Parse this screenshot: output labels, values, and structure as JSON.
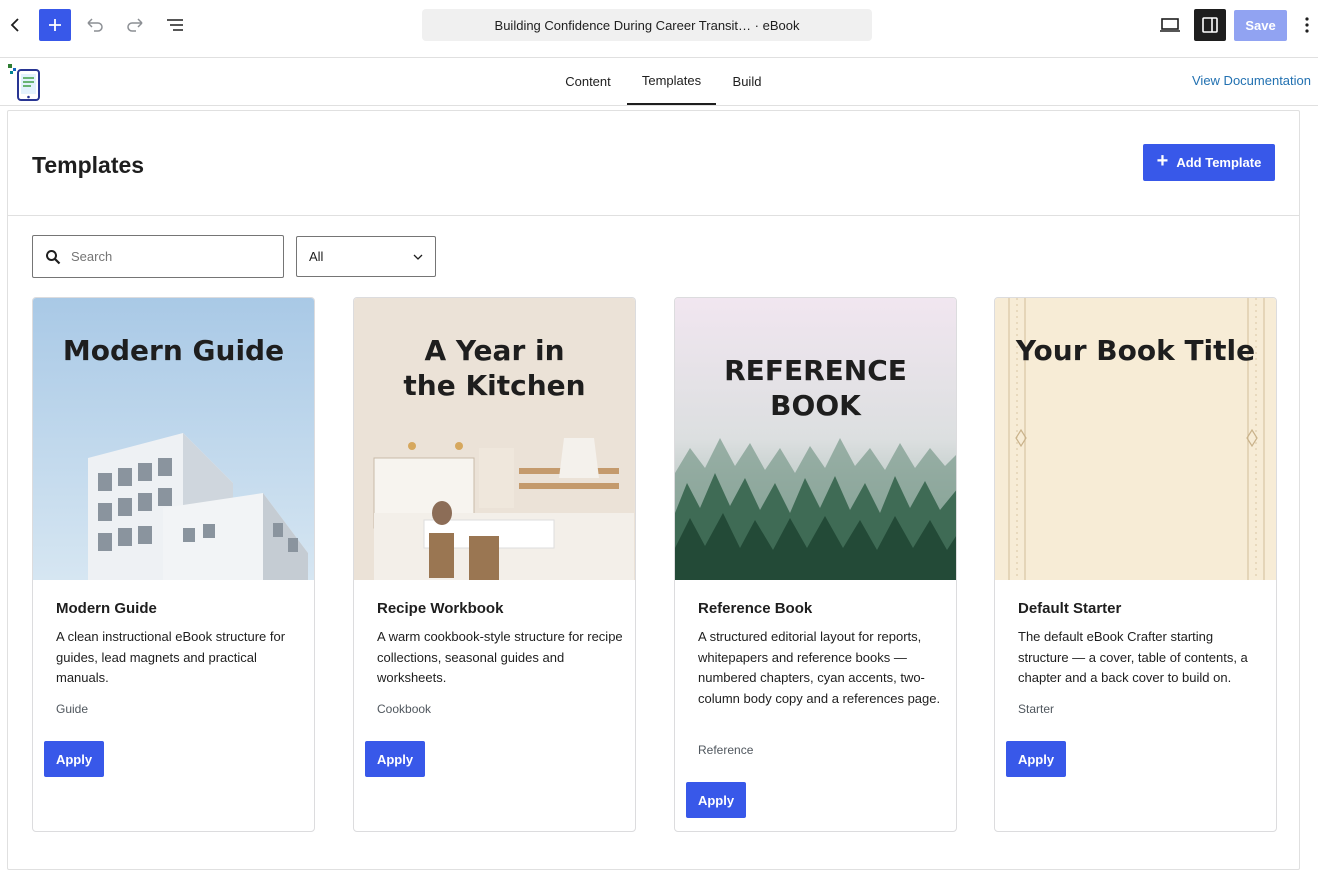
{
  "toolbar": {
    "document_title": "Building Confidence During Career Transit…  · eBook",
    "save_label": "Save",
    "accent_color": "#3858e9"
  },
  "nav": {
    "tabs": [
      {
        "label": "Content"
      },
      {
        "label": "Templates",
        "active": true
      },
      {
        "label": "Build"
      }
    ],
    "docs_link": "View Documentation"
  },
  "templates_page": {
    "title": "Templates",
    "add_button": "Add Template",
    "search_placeholder": "Search",
    "filter_value": "All"
  },
  "cards": [
    {
      "cover_title": "Modern Guide",
      "name": "Modern Guide",
      "description": "A clean instructional eBook structure for guides, lead magnets and practical manuals.",
      "category": "Guide",
      "apply_label": "Apply"
    },
    {
      "cover_title_line1": "A Year in",
      "cover_title_line2": "the Kitchen",
      "name": "Recipe Workbook",
      "description": "A warm cookbook-style structure for recipe collections, seasonal guides and worksheets.",
      "category": "Cookbook",
      "apply_label": "Apply"
    },
    {
      "cover_title_line1": "REFERENCE",
      "cover_title_line2": "BOOK",
      "name": "Reference Book",
      "description": "A structured editorial layout for reports, whitepapers and reference books — numbered chapters, cyan accents, two-column body copy and a references page.",
      "category": "Reference",
      "apply_label": "Apply"
    },
    {
      "cover_title": "Your Book Title",
      "name": "Default Starter",
      "description": "The default eBook Crafter starting structure — a cover, table of contents, a chapter and a back cover to build on.",
      "category": "Starter",
      "apply_label": "Apply"
    }
  ]
}
